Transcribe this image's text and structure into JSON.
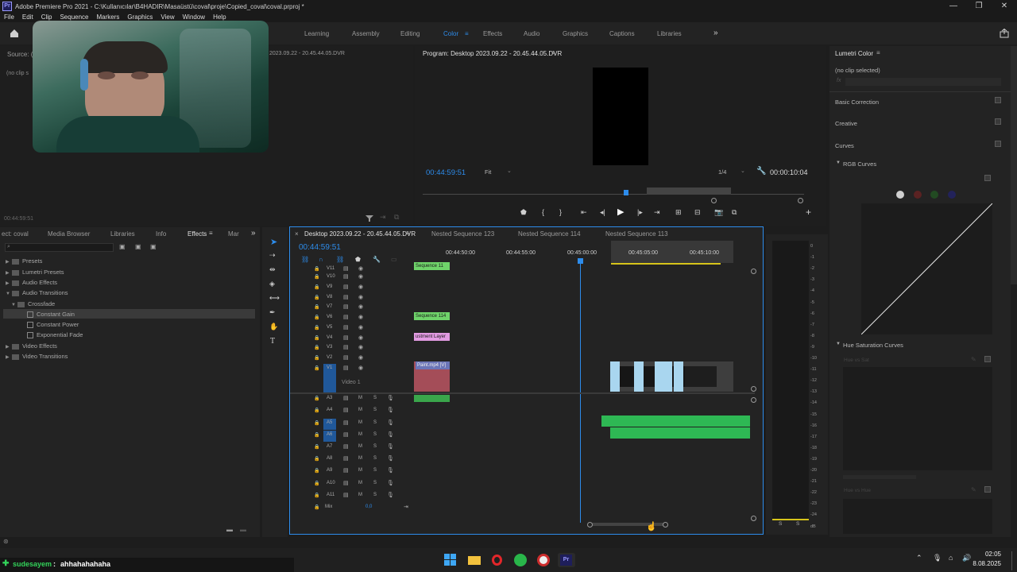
{
  "window": {
    "title": "Adobe Premiere Pro 2021 - C:\\Kullanıcılar\\B4HADIR\\Masaüstü\\coval\\proje\\Copied_coval\\coval.prproj *",
    "logo": "Pr"
  },
  "menu": [
    "File",
    "Edit",
    "Clip",
    "Sequence",
    "Markers",
    "Graphics",
    "View",
    "Window",
    "Help"
  ],
  "workspaces": [
    "Learning",
    "Assembly",
    "Editing",
    "Color",
    "Effects",
    "Audio",
    "Graphics",
    "Captions",
    "Libraries"
  ],
  "active_workspace": "Color",
  "source_panel": {
    "label": "Source: (",
    "no_clip": "(no clip s",
    "header_clip": "2023.09.22 - 20.45.44.05.DVR",
    "timecode": "00:44:59:51"
  },
  "program": {
    "title": "Program: Desktop 2023.09.22 - 20.45.44.05.DVR",
    "timecode": "00:44:59:51",
    "fit": "Fit",
    "quality": "1/4",
    "duration": "00:00:10:04"
  },
  "effects_panel": {
    "tabs": [
      "ect: coval",
      "Media Browser",
      "Libraries",
      "Info",
      "Effects",
      "Mar"
    ],
    "active_tab": "Effects",
    "tree": [
      {
        "label": "Presets",
        "depth": 0,
        "type": "folder"
      },
      {
        "label": "Lumetri Presets",
        "depth": 0,
        "type": "folder"
      },
      {
        "label": "Audio Effects",
        "depth": 0,
        "type": "folder"
      },
      {
        "label": "Audio Transitions",
        "depth": 0,
        "type": "folder",
        "open": true
      },
      {
        "label": "Crossfade",
        "depth": 1,
        "type": "folder",
        "open": true
      },
      {
        "label": "Constant Gain",
        "depth": 2,
        "type": "effect",
        "selected": true
      },
      {
        "label": "Constant Power",
        "depth": 2,
        "type": "effect"
      },
      {
        "label": "Exponential Fade",
        "depth": 2,
        "type": "effect"
      },
      {
        "label": "Video Effects",
        "depth": 0,
        "type": "folder"
      },
      {
        "label": "Video Transitions",
        "depth": 0,
        "type": "folder"
      }
    ]
  },
  "timeline": {
    "tabs": [
      "Desktop 2023.09.22 - 20.45.44.05.DVR",
      "Nested Sequence 123",
      "Nested Sequence 114",
      "Nested Sequence 113"
    ],
    "timecode": "00:44:59:51",
    "ruler": [
      "00:44:50:00",
      "00:44:55:00",
      "00:45:00:00",
      "00:45:05:00",
      "00:45:10:00"
    ],
    "video_tracks": [
      "V11",
      "V10",
      "V9",
      "V8",
      "V7",
      "V6",
      "V5",
      "V4",
      "V3",
      "V2",
      "V1"
    ],
    "v1_name": "Video 1",
    "audio_tracks": [
      "A3",
      "A4",
      "A5",
      "A6",
      "A7",
      "A8",
      "A9",
      "A10",
      "A11"
    ],
    "mix_label": "Mix",
    "mix_value": "0,0",
    "clips": {
      "v11": "Sequence 11",
      "v6": "Sequence 114",
      "v4": "ustment Layer",
      "v1": "Paint.mp4 [V]"
    }
  },
  "meters": {
    "scale": [
      "0",
      "-1",
      "-2",
      "-3",
      "-4",
      "-5",
      "-6",
      "-7",
      "-8",
      "-9",
      "-10",
      "-11",
      "-12",
      "-13",
      "-14",
      "-15",
      "-16",
      "-17",
      "-18",
      "-19",
      "-20",
      "-21",
      "-22",
      "-23",
      "-24",
      "dB"
    ],
    "solo": [
      "S",
      "S"
    ]
  },
  "lumetri": {
    "title": "Lumetri Color",
    "no_clip": "(no clip selected)",
    "fx": "fx",
    "sections": [
      "Basic Correction",
      "Creative",
      "Curves"
    ],
    "rgb_curves": "RGB Curves",
    "hue_sat": "Hue Saturation Curves",
    "hue_vs_sat": "Hue vs Sat",
    "hue_vs_hue": "Hue vs Hue"
  },
  "chat": {
    "user": "sudesayem",
    "separator": " : ",
    "message": "ahhahahahaha"
  },
  "taskbar": {
    "time": "02:05",
    "date": "8.08.2025"
  }
}
